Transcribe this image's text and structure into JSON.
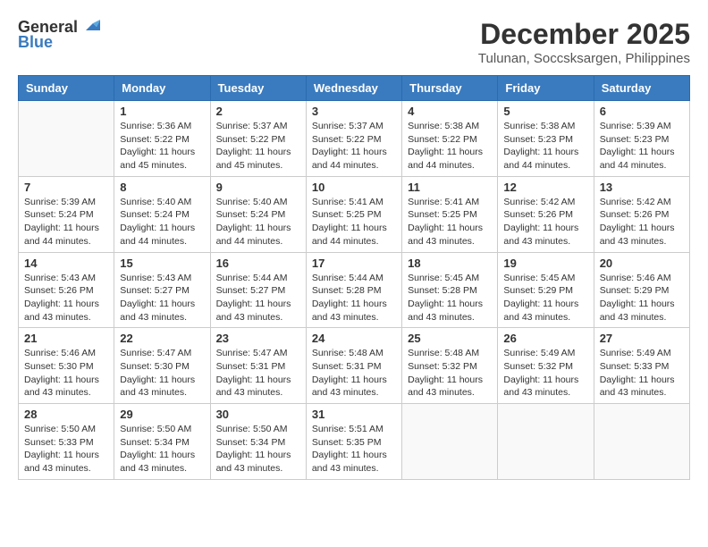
{
  "header": {
    "logo_line1": "General",
    "logo_line2": "Blue",
    "month_title": "December 2025",
    "location": "Tulunan, Soccsksargen, Philippines"
  },
  "weekdays": [
    "Sunday",
    "Monday",
    "Tuesday",
    "Wednesday",
    "Thursday",
    "Friday",
    "Saturday"
  ],
  "weeks": [
    [
      {
        "day": "",
        "info": ""
      },
      {
        "day": "1",
        "info": "Sunrise: 5:36 AM\nSunset: 5:22 PM\nDaylight: 11 hours\nand 45 minutes."
      },
      {
        "day": "2",
        "info": "Sunrise: 5:37 AM\nSunset: 5:22 PM\nDaylight: 11 hours\nand 45 minutes."
      },
      {
        "day": "3",
        "info": "Sunrise: 5:37 AM\nSunset: 5:22 PM\nDaylight: 11 hours\nand 44 minutes."
      },
      {
        "day": "4",
        "info": "Sunrise: 5:38 AM\nSunset: 5:22 PM\nDaylight: 11 hours\nand 44 minutes."
      },
      {
        "day": "5",
        "info": "Sunrise: 5:38 AM\nSunset: 5:23 PM\nDaylight: 11 hours\nand 44 minutes."
      },
      {
        "day": "6",
        "info": "Sunrise: 5:39 AM\nSunset: 5:23 PM\nDaylight: 11 hours\nand 44 minutes."
      }
    ],
    [
      {
        "day": "7",
        "info": "Sunrise: 5:39 AM\nSunset: 5:24 PM\nDaylight: 11 hours\nand 44 minutes."
      },
      {
        "day": "8",
        "info": "Sunrise: 5:40 AM\nSunset: 5:24 PM\nDaylight: 11 hours\nand 44 minutes."
      },
      {
        "day": "9",
        "info": "Sunrise: 5:40 AM\nSunset: 5:24 PM\nDaylight: 11 hours\nand 44 minutes."
      },
      {
        "day": "10",
        "info": "Sunrise: 5:41 AM\nSunset: 5:25 PM\nDaylight: 11 hours\nand 44 minutes."
      },
      {
        "day": "11",
        "info": "Sunrise: 5:41 AM\nSunset: 5:25 PM\nDaylight: 11 hours\nand 43 minutes."
      },
      {
        "day": "12",
        "info": "Sunrise: 5:42 AM\nSunset: 5:26 PM\nDaylight: 11 hours\nand 43 minutes."
      },
      {
        "day": "13",
        "info": "Sunrise: 5:42 AM\nSunset: 5:26 PM\nDaylight: 11 hours\nand 43 minutes."
      }
    ],
    [
      {
        "day": "14",
        "info": "Sunrise: 5:43 AM\nSunset: 5:26 PM\nDaylight: 11 hours\nand 43 minutes."
      },
      {
        "day": "15",
        "info": "Sunrise: 5:43 AM\nSunset: 5:27 PM\nDaylight: 11 hours\nand 43 minutes."
      },
      {
        "day": "16",
        "info": "Sunrise: 5:44 AM\nSunset: 5:27 PM\nDaylight: 11 hours\nand 43 minutes."
      },
      {
        "day": "17",
        "info": "Sunrise: 5:44 AM\nSunset: 5:28 PM\nDaylight: 11 hours\nand 43 minutes."
      },
      {
        "day": "18",
        "info": "Sunrise: 5:45 AM\nSunset: 5:28 PM\nDaylight: 11 hours\nand 43 minutes."
      },
      {
        "day": "19",
        "info": "Sunrise: 5:45 AM\nSunset: 5:29 PM\nDaylight: 11 hours\nand 43 minutes."
      },
      {
        "day": "20",
        "info": "Sunrise: 5:46 AM\nSunset: 5:29 PM\nDaylight: 11 hours\nand 43 minutes."
      }
    ],
    [
      {
        "day": "21",
        "info": "Sunrise: 5:46 AM\nSunset: 5:30 PM\nDaylight: 11 hours\nand 43 minutes."
      },
      {
        "day": "22",
        "info": "Sunrise: 5:47 AM\nSunset: 5:30 PM\nDaylight: 11 hours\nand 43 minutes."
      },
      {
        "day": "23",
        "info": "Sunrise: 5:47 AM\nSunset: 5:31 PM\nDaylight: 11 hours\nand 43 minutes."
      },
      {
        "day": "24",
        "info": "Sunrise: 5:48 AM\nSunset: 5:31 PM\nDaylight: 11 hours\nand 43 minutes."
      },
      {
        "day": "25",
        "info": "Sunrise: 5:48 AM\nSunset: 5:32 PM\nDaylight: 11 hours\nand 43 minutes."
      },
      {
        "day": "26",
        "info": "Sunrise: 5:49 AM\nSunset: 5:32 PM\nDaylight: 11 hours\nand 43 minutes."
      },
      {
        "day": "27",
        "info": "Sunrise: 5:49 AM\nSunset: 5:33 PM\nDaylight: 11 hours\nand 43 minutes."
      }
    ],
    [
      {
        "day": "28",
        "info": "Sunrise: 5:50 AM\nSunset: 5:33 PM\nDaylight: 11 hours\nand 43 minutes."
      },
      {
        "day": "29",
        "info": "Sunrise: 5:50 AM\nSunset: 5:34 PM\nDaylight: 11 hours\nand 43 minutes."
      },
      {
        "day": "30",
        "info": "Sunrise: 5:50 AM\nSunset: 5:34 PM\nDaylight: 11 hours\nand 43 minutes."
      },
      {
        "day": "31",
        "info": "Sunrise: 5:51 AM\nSunset: 5:35 PM\nDaylight: 11 hours\nand 43 minutes."
      },
      {
        "day": "",
        "info": ""
      },
      {
        "day": "",
        "info": ""
      },
      {
        "day": "",
        "info": ""
      }
    ]
  ]
}
